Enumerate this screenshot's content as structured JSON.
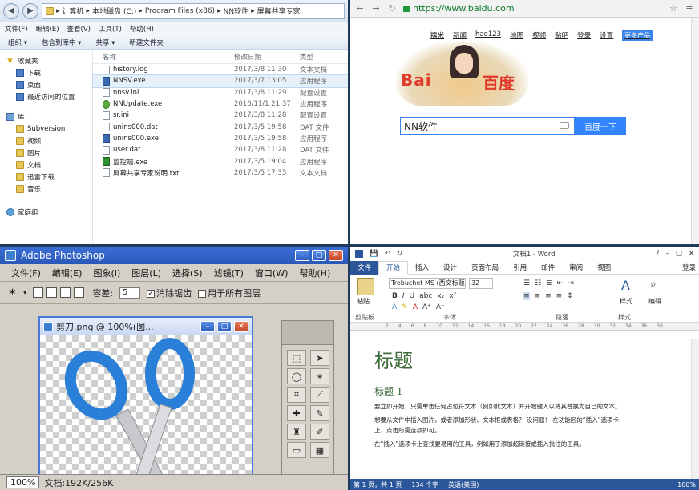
{
  "explorer": {
    "breadcrumb": [
      "计算机",
      "本地磁盘 (C:)",
      "Program Files (x86)",
      "NN软件",
      "屏幕共享专家"
    ],
    "menu": [
      "文件(F)",
      "编辑(E)",
      "查看(V)",
      "工具(T)",
      "帮助(H)"
    ],
    "toolbar": [
      "组织 ▾",
      "包含到库中 ▾",
      "共享 ▾",
      "新建文件夹"
    ],
    "columns": {
      "name": "名称",
      "date": "修改日期",
      "type": "类型"
    },
    "sidebar": {
      "favorites": "收藏夹",
      "fav_items": [
        "下载",
        "桌面",
        "最近访问的位置"
      ],
      "library": "库",
      "lib_items": [
        "Subversion",
        "视频",
        "图片",
        "文档",
        "迅雷下载",
        "音乐"
      ],
      "homegroup": "家庭组"
    },
    "files": [
      {
        "name": "history.log",
        "date": "2017/3/8 11:30",
        "type": "文本文档",
        "icon": "text"
      },
      {
        "name": "NNSV.exe",
        "date": "2017/3/7 13:05",
        "type": "应用程序",
        "icon": "exe"
      },
      {
        "name": "nnsv.ini",
        "date": "2017/3/8 11:29",
        "type": "配置设置",
        "icon": "text"
      },
      {
        "name": "NNUpdate.exe",
        "date": "2016/11/1 21:37",
        "type": "应用程序",
        "icon": "upd"
      },
      {
        "name": "sr.ini",
        "date": "2017/3/8 11:28",
        "type": "配置设置",
        "icon": "text"
      },
      {
        "name": "unins000.dat",
        "date": "2017/3/5 19:58",
        "type": "DAT 文件",
        "icon": "text"
      },
      {
        "name": "unins000.exe",
        "date": "2017/3/5 19:58",
        "type": "应用程序",
        "icon": "exe"
      },
      {
        "name": "user.dat",
        "date": "2017/3/8 11:28",
        "type": "DAT 文件",
        "icon": "text"
      },
      {
        "name": "监控端.exe",
        "date": "2017/3/5 19:04",
        "type": "应用程序",
        "icon": "ctl"
      },
      {
        "name": "屏幕共享专家说明.txt",
        "date": "2017/3/5 17:35",
        "type": "文本文档",
        "icon": "text"
      }
    ]
  },
  "browser": {
    "url": "https://www.baidu.com",
    "links": [
      "糯米",
      "新闻",
      "hao123",
      "地图",
      "视频",
      "贴吧",
      "登录",
      "设置"
    ],
    "more": "更多产品",
    "logo_left": "Bai",
    "logo_right": "百度",
    "search_value": "NN软件",
    "search_button": "百度一下"
  },
  "photoshop": {
    "title": "Adobe Photoshop",
    "menu": [
      "文件(F)",
      "编辑(E)",
      "图象(I)",
      "图层(L)",
      "选择(S)",
      "滤镜(T)",
      "窗口(W)",
      "帮助(H)"
    ],
    "tolerance_label": "容差:",
    "tolerance_value": "5",
    "antialias_label": "消除锯齿",
    "all_layers_label": "用于所有图层",
    "doc_title": "剪刀.png @ 100%(图...",
    "zoom": "100%",
    "status": "文档:192K/256K"
  },
  "word": {
    "title": "文档1 - Word",
    "tabs": [
      "文件",
      "开始",
      "插入",
      "设计",
      "页面布局",
      "引用",
      "邮件",
      "审阅",
      "视图"
    ],
    "login": "登录",
    "font_name": "Trebuchet MS (西文标题",
    "font_size": "32",
    "paste": "粘贴",
    "styles": "样式",
    "editing": "编辑",
    "group_labels": [
      "剪贴板",
      "字体",
      "段落",
      "样式"
    ],
    "heading_title": "标题",
    "heading_1": "标题 1",
    "paragraphs": [
      "要立即开始，只需单击任何占位符文本（例如此文本）并开始键入以将其替换为自己的文本。",
      "想要从文件中插入图片，或者添加形状、文本框或表格？ 没问题！ 在功能区的“插入”选项卡",
      "上，点击所需选项即可。",
      "在“插入”选项卡上查找更易用的工具，例如用于添加超链接或插入批注的工具。"
    ],
    "status": {
      "page": "第 1 页，共 1 页",
      "words": "134 个字",
      "lang": "英语(美国)",
      "zoom": "100%"
    }
  }
}
